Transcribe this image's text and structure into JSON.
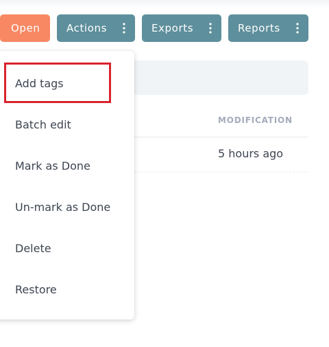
{
  "toolbar": {
    "open_label": "Open",
    "actions_label": "Actions",
    "exports_label": "Exports",
    "reports_label": "Reports",
    "menu_icon": "kebab-vertical-icon"
  },
  "table": {
    "header_modification": "MODIFICATION",
    "rows": [
      {
        "modification": "5 hours ago"
      }
    ]
  },
  "actions_menu": {
    "items": [
      {
        "label": "Add tags",
        "highlighted": true
      },
      {
        "label": "Batch edit"
      },
      {
        "label": "Mark as Done"
      },
      {
        "label": "Un-mark as Done"
      },
      {
        "label": "Delete"
      },
      {
        "label": "Restore"
      }
    ],
    "highlight_color": "#d9232d"
  },
  "colors": {
    "primary_orange": "#f78863",
    "teal": "#5e8f9c"
  }
}
